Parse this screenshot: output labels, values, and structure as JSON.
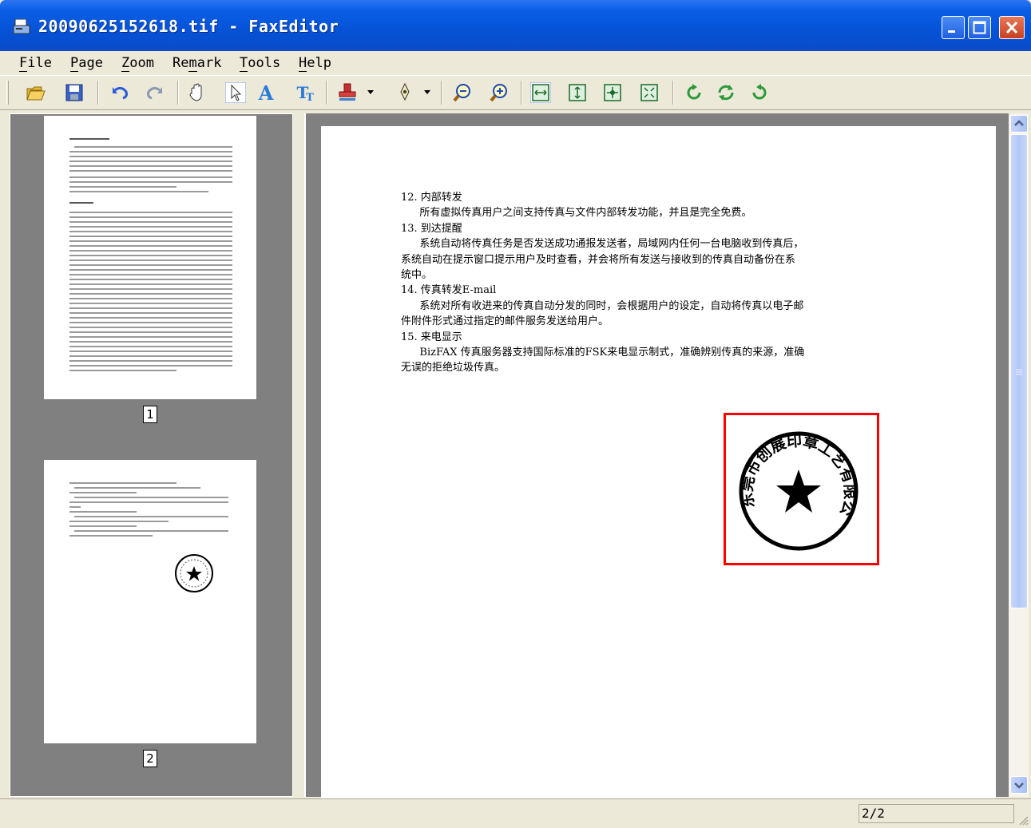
{
  "window": {
    "title": "20090625152618.tif - FaxEditor",
    "title_bar_color": "#0a5fe6",
    "buttons": [
      "minimize",
      "maximize",
      "close"
    ]
  },
  "menu": [
    {
      "key": "F",
      "rest": "ile"
    },
    {
      "key": "P",
      "rest": "age"
    },
    {
      "key": "Z",
      "rest": "oom"
    },
    {
      "pre": "Re",
      "key": "m",
      "rest": "ark"
    },
    {
      "key": "T",
      "rest": "ools"
    },
    {
      "key": "H",
      "rest": "elp"
    }
  ],
  "toolbar_icons": [
    "open-folder-icon",
    "save-icon",
    "undo-icon",
    "redo-icon",
    "hand-pan-icon",
    "select-arrow-icon",
    "text-icon",
    "text-box-icon",
    "stamp-icon",
    "pen-icon",
    "zoom-out-icon",
    "zoom-in-icon",
    "fit-width-icon",
    "fit-height-icon",
    "fit-page-icon",
    "actual-size-icon",
    "rotate-left-icon",
    "rotate-180-icon",
    "rotate-right-icon"
  ],
  "thumbnails": [
    {
      "number": "1"
    },
    {
      "number": "2"
    }
  ],
  "document": {
    "lines": [
      {
        "text": "12. 内部转发",
        "indent": false
      },
      {
        "text": "所有虚拟传真用户之间支持传真与文件内部转发功能，并且是完全免费。",
        "indent": true
      },
      {
        "text": "13. 到达提醒",
        "indent": false
      },
      {
        "text": "系统自动将传真任务是否发送成功通报发送者，局域网内任何一台电脑收到传真后，",
        "indent": true
      },
      {
        "text": "系统自动在提示窗口提示用户及时查看，并会将所有发送与接收到的传真自动备份在系",
        "indent": false
      },
      {
        "text": "统中。",
        "indent": false
      },
      {
        "text": "14. 传真转发E-mail",
        "indent": false
      },
      {
        "text": "系统对所有收进来的传真自动分发的同时，会根据用户的设定，自动将传真以电子邮",
        "indent": true
      },
      {
        "text": "件附件形式通过指定的邮件服务发送给用户。",
        "indent": false
      },
      {
        "text": "15. 来电显示",
        "indent": false
      },
      {
        "text": "BizFAX 传真服务器支持国际标准的FSK来电显示制式，准确辨别传真的来源，准确",
        "indent": true
      },
      {
        "text": "无误的拒绝垃圾传真。",
        "indent": false
      }
    ],
    "stamp_text": "东莞市创展印章工艺有限公司",
    "stamp_highlight_color": "#ff0000"
  },
  "status": {
    "page_indicator": "2/2"
  }
}
